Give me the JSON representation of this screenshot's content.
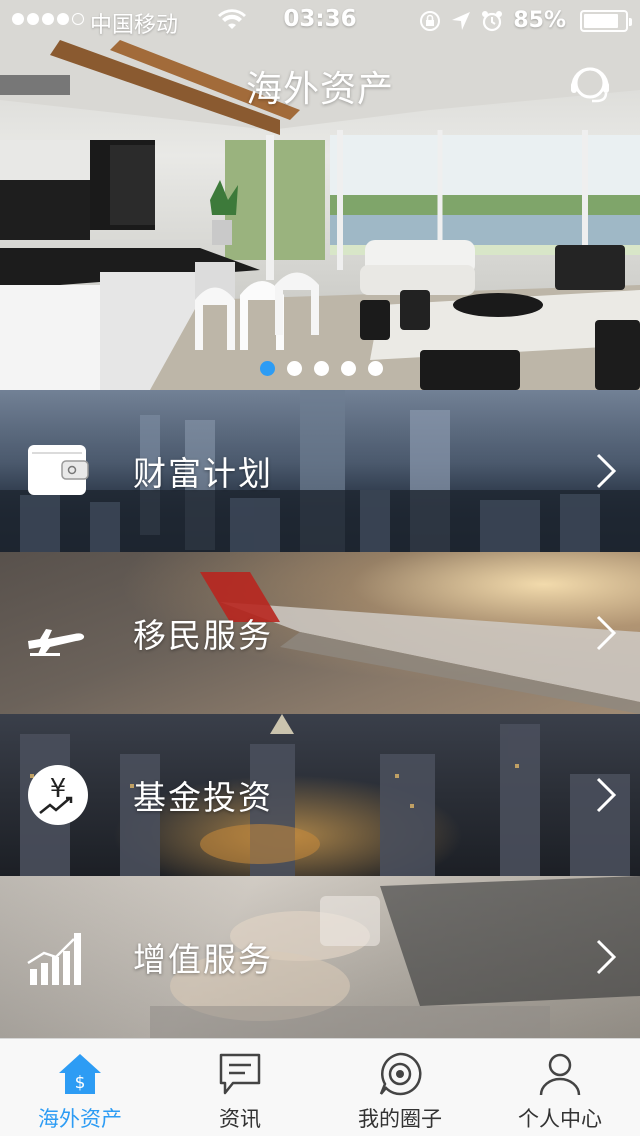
{
  "status_bar": {
    "carrier": "中国移动",
    "time": "03:36",
    "battery_percent": "85%",
    "battery_level": 0.85,
    "signal_bars_filled": 4,
    "signal_bars_total": 5
  },
  "header": {
    "title": "海外资产",
    "right_icon": "customer-service-headset-icon"
  },
  "carousel": {
    "total_slides": 5,
    "active_index": 0,
    "active_color": "#2d9cf4"
  },
  "menu": {
    "items": [
      {
        "label": "财富计划",
        "icon": "wallet-icon"
      },
      {
        "label": "移民服务",
        "icon": "airplane-icon"
      },
      {
        "label": "基金投资",
        "icon": "yen-growth-icon"
      },
      {
        "label": "增值服务",
        "icon": "bar-growth-icon"
      }
    ]
  },
  "tabbar": {
    "active_index": 0,
    "accent_color": "#2d9cf4",
    "tabs": [
      {
        "label": "海外资产",
        "icon": "home-dollar-icon"
      },
      {
        "label": "资讯",
        "icon": "message-icon"
      },
      {
        "label": "我的圈子",
        "icon": "circle-target-icon"
      },
      {
        "label": "个人中心",
        "icon": "person-icon"
      }
    ]
  }
}
